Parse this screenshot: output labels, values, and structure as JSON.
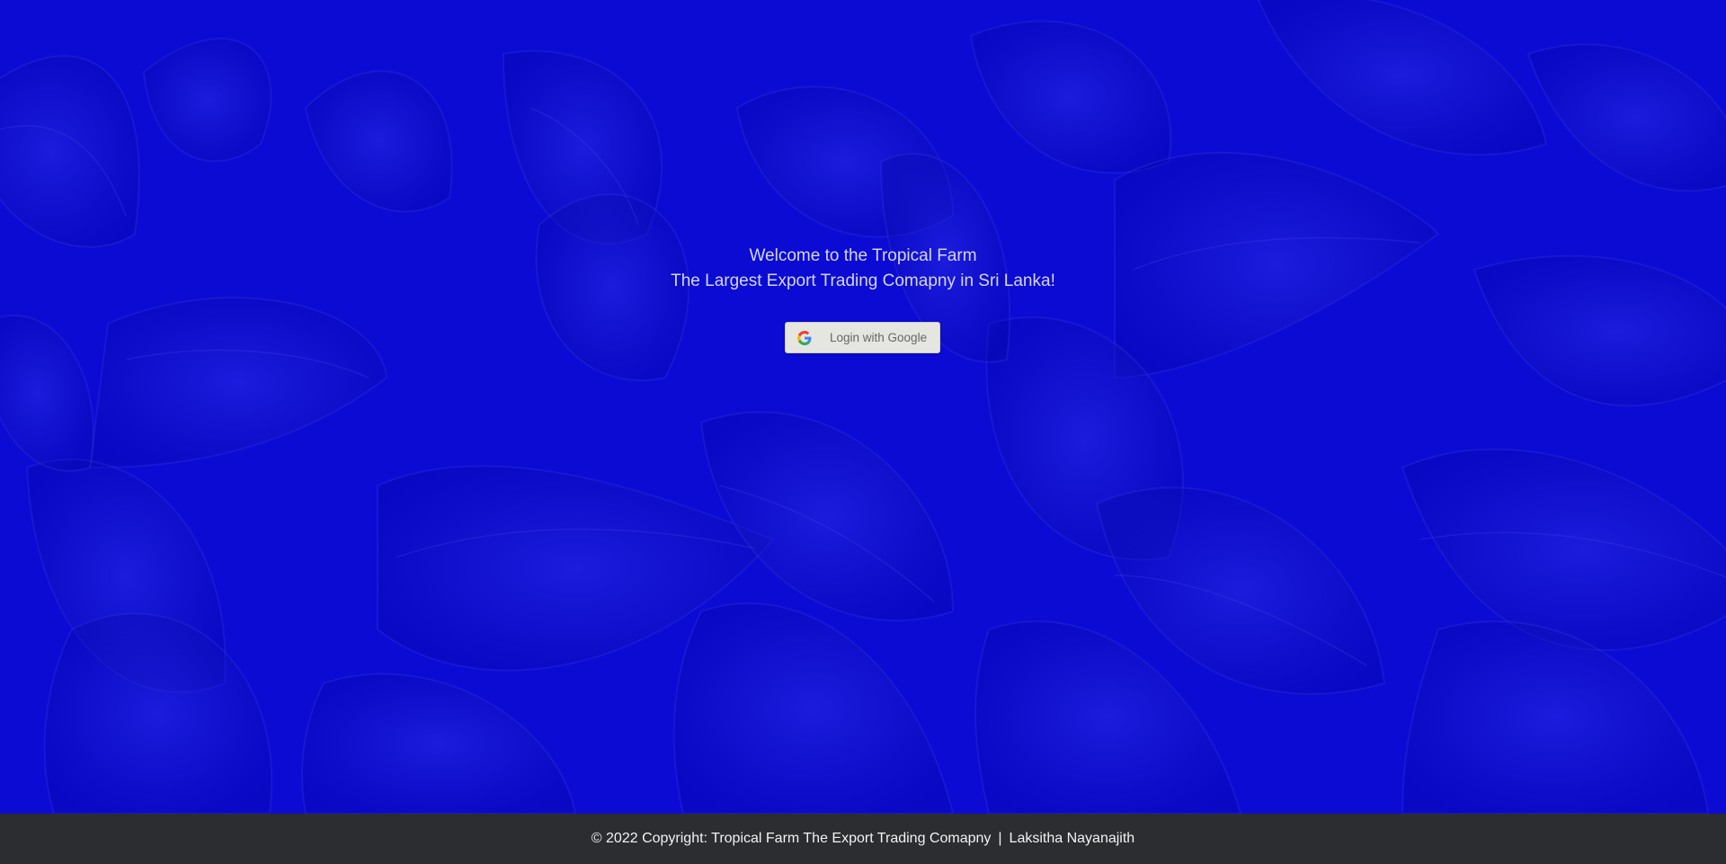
{
  "hero": {
    "welcome_line1": "Welcome to the Tropical Farm",
    "welcome_line2": "The Largest Export Trading Comapny in Sri Lanka!",
    "login_button_label": "Login with Google",
    "login_button_icon": "google-icon",
    "background_color": "#0a0ad6"
  },
  "footer": {
    "copyright": "© 2022 Copyright: Tropical Farm The Export Trading Comapny",
    "separator": "|",
    "author": "Laksitha Nayanajith",
    "background_color": "#2b2d30"
  }
}
